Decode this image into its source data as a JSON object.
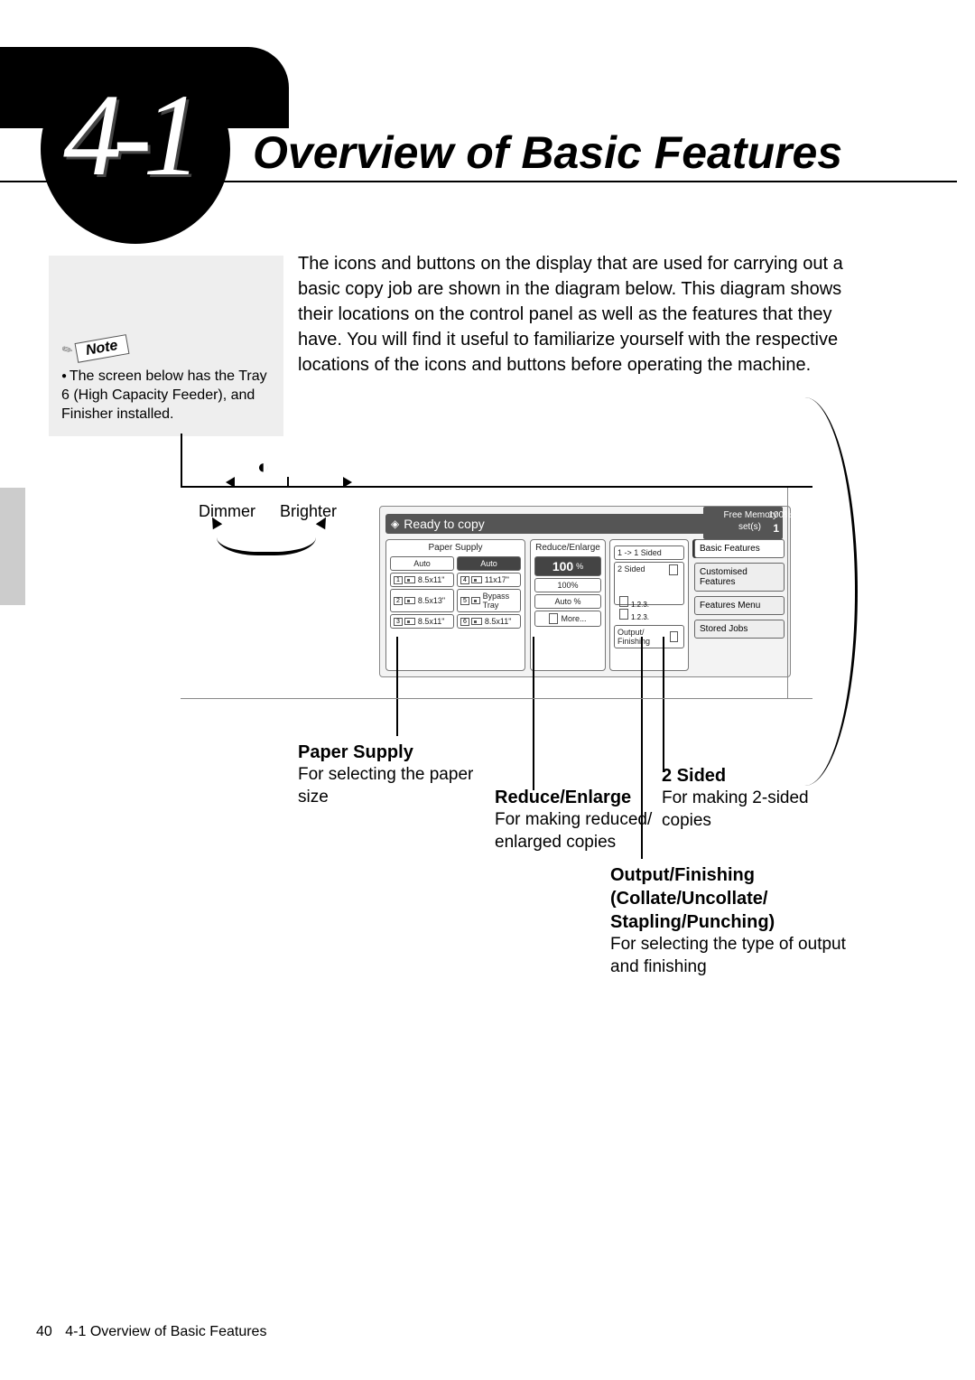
{
  "section_number": "4-1",
  "page_title": "Overview of Basic Features",
  "intro_text": "The icons and buttons on the display that are used for carrying out a basic copy job are shown in the diagram below. This diagram shows their locations on the control panel as well as the features that they have. You will find it useful to familiarize yourself with the respective locations of the icons and buttons before operating the machine.",
  "note": {
    "label": "Note",
    "text": "The screen below has the Tray 6 (High Capacity Feeder), and Finisher installed."
  },
  "brightness": {
    "dimmer": "Dimmer",
    "brighter": "Brighter"
  },
  "screen": {
    "status": "Ready to copy",
    "free_memory_label": "Free Memory",
    "free_memory_value": "100%",
    "sets_label": "set(s)",
    "sets_value": "1",
    "paper_supply": {
      "title": "Paper Supply",
      "auto_a": "Auto",
      "auto_b": "Auto",
      "trays": {
        "t1": "8.5x11\"",
        "t2": "8.5x13\"",
        "t3": "8.5x11\"",
        "t4": "11x17\"",
        "t5": "Bypass Tray",
        "t6": "8.5x11\""
      },
      "nums": {
        "n1": "1",
        "n2": "2",
        "n3": "3",
        "n4": "4",
        "n5": "5",
        "n6": "6"
      }
    },
    "reduce_enlarge": {
      "title": "Reduce/Enlarge",
      "value": "100",
      "pct": "%",
      "opt1": "100%",
      "opt2": "Auto %",
      "opt3": "More..."
    },
    "sided": {
      "opt1": "1 -> 1 Sided",
      "opt2": "2 Sided",
      "anno1": "1.2.3.",
      "anno2": "1.2.3.",
      "opt3": "Output/ Finishing"
    },
    "tabs": {
      "t1": "Basic Features",
      "t2": "Customised Features",
      "t3": "Features Menu",
      "t4": "Stored Jobs"
    }
  },
  "callouts": {
    "paper_supply": {
      "h": "Paper Supply",
      "b": "For selecting the paper size"
    },
    "reduce_enlarge": {
      "h": "Reduce/Enlarge",
      "b": "For making reduced/ enlarged copies"
    },
    "two_sided": {
      "h": "2 Sided",
      "b": "For making 2-sided copies"
    },
    "output": {
      "h1": "Output/Finishing",
      "h2": "(Collate/Uncollate/",
      "h3": "Stapling/Punching)",
      "b": "For selecting the type of output and finishing"
    }
  },
  "footer": {
    "page_num": "40",
    "crumb": "4-1  Overview of Basic Features"
  }
}
